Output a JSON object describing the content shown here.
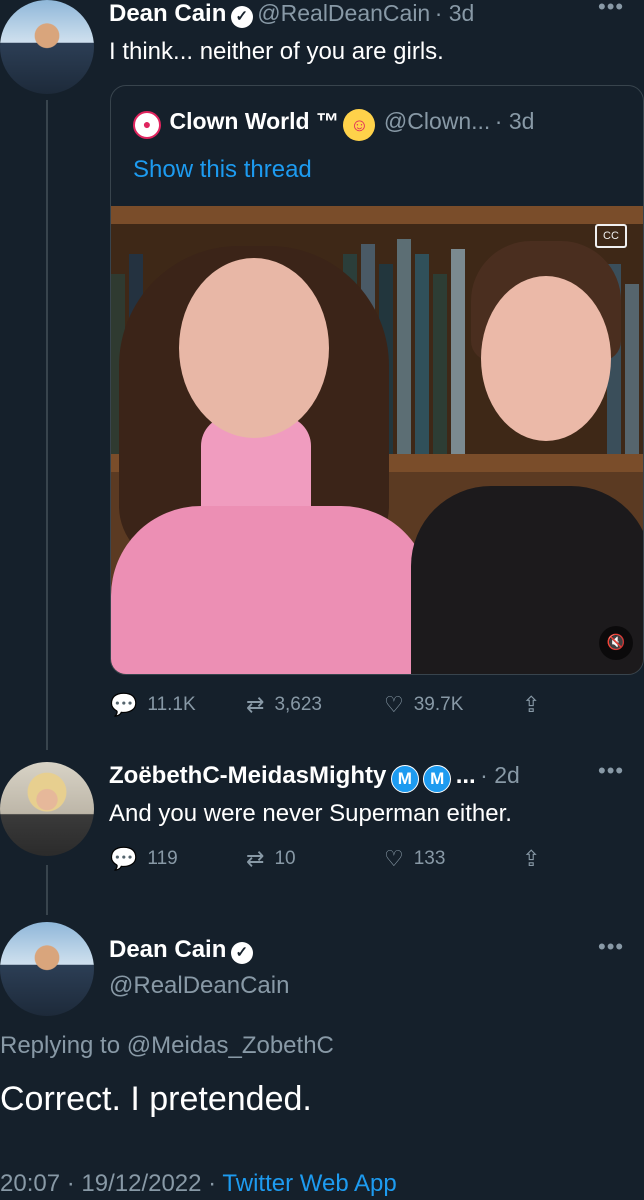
{
  "tweet1": {
    "name": "Dean Cain",
    "handle": "@RealDeanCain",
    "time": "· 3d",
    "text": "I think... neither of you are girls."
  },
  "quote": {
    "name": "Clown World ™",
    "handle": "@Clown...",
    "time": "· 3d",
    "show_thread": "Show this thread",
    "cc_label": "CC",
    "mute_icon": "speaker-muted"
  },
  "tweet1_actions": {
    "replies": "11.1K",
    "retweets": "3,623",
    "likes": "39.7K"
  },
  "reply": {
    "name": "ZoëbethC-MeidasMighty",
    "badges": [
      "M",
      "M"
    ],
    "ellipsis": "...",
    "time": "· 2d",
    "text": "And you were never Superman either.",
    "replies": "119",
    "retweets": "10",
    "likes": "133"
  },
  "main": {
    "name": "Dean Cain",
    "handle": "@RealDeanCain",
    "replying_prefix": "Replying to ",
    "replying_to": "@Meidas_ZobethC",
    "text": "Correct. I pretended.",
    "timestamp": "20:07 · 19/12/2022 · ",
    "source": "Twitter Web App"
  },
  "icons": {
    "reply": "reply-icon",
    "retweet": "retweet-icon",
    "like": "heart-icon",
    "share": "share-icon",
    "more": "more-icon",
    "verified": "verified-badge-icon"
  },
  "colors": {
    "background": "#15202b",
    "accent": "#1d9bf0",
    "muted": "#8899a6",
    "border": "#38444d"
  }
}
